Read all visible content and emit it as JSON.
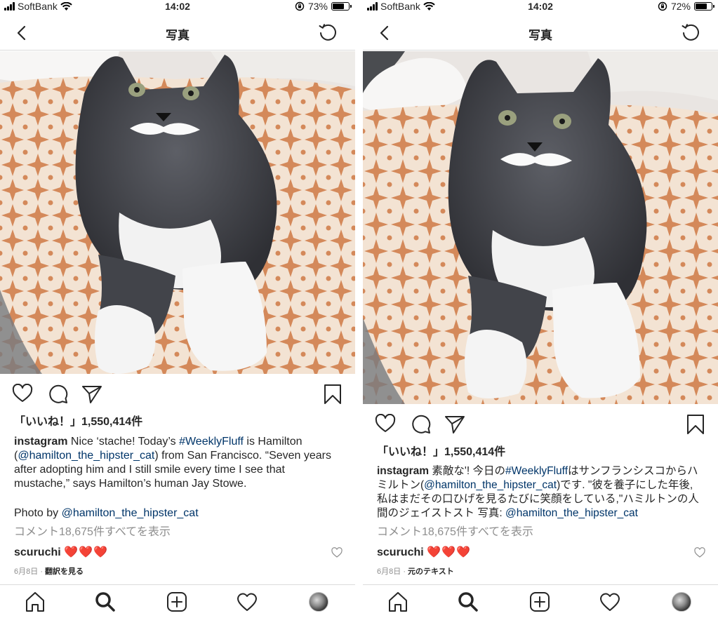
{
  "screens": [
    {
      "status": {
        "carrier": "SoftBank",
        "time": "14:02",
        "battery": "73%",
        "battery_level": 0.73
      },
      "nav": {
        "title": "写真"
      },
      "likes": "「いいね！」1,550,414件",
      "caption": {
        "username": "instagram",
        "segments": [
          {
            "t": " Nice ‘stache! Today’s ",
            "k": "text"
          },
          {
            "t": "#WeeklyFluff",
            "k": "hashtag"
          },
          {
            "t": " is Hamilton (",
            "k": "text"
          },
          {
            "t": "@hamilton_the_hipster_cat",
            "k": "mention"
          },
          {
            "t": ") from San Francisco. “Seven years after adopting him and I still smile every time I see that mustache,” says Hamilton’s human Jay Stowe.",
            "k": "text"
          }
        ],
        "credit_prefix": "Photo by ",
        "credit_mention": "@hamilton_the_hipster_cat"
      },
      "view_comments": "コメント18,675件すべてを表示",
      "comment": {
        "username": "scuruchi",
        "hearts": "❤️❤️❤️",
        "date": "6月8日",
        "action": "翻訳を見る"
      }
    },
    {
      "status": {
        "carrier": "SoftBank",
        "time": "14:02",
        "battery": "72%",
        "battery_level": 0.72
      },
      "nav": {
        "title": "写真"
      },
      "likes": "「いいね！」1,550,414件",
      "caption": {
        "username": "instagram",
        "segments": [
          {
            "t": " 素敵な'! 今日の",
            "k": "text"
          },
          {
            "t": "#WeeklyFluff",
            "k": "hashtag"
          },
          {
            "t": "はサンフランシスコからハミルトン(",
            "k": "text"
          },
          {
            "t": "@hamilton_the_hipster_cat",
            "k": "mention"
          },
          {
            "t": ")です. \"彼を養子にした年後, 私はまだその口ひげを見るたびに笑顔をしている,\"ハミルトンの人間のジェイストスト 写真: ",
            "k": "text"
          },
          {
            "t": "@hamilton_the_hipster_cat",
            "k": "mention"
          }
        ],
        "credit_prefix": "",
        "credit_mention": ""
      },
      "view_comments": "コメント18,675件すべてを表示",
      "comment": {
        "username": "scuruchi",
        "hearts": "❤️❤️❤️",
        "date": "6月8日",
        "action": "元のテキスト"
      }
    }
  ],
  "icons": {
    "back": "chevron-left-icon",
    "refresh": "refresh-icon",
    "like": "heart-outline-icon",
    "comment": "comment-bubble-icon",
    "share": "paper-plane-icon",
    "save": "bookmark-icon",
    "home": "home-icon",
    "search": "search-icon",
    "new_post": "plus-square-icon",
    "activity": "heart-outline-icon",
    "profile": "avatar"
  },
  "colors": {
    "text": "#262626",
    "link": "#003569",
    "muted": "#8e8e8e",
    "heart": "#ed4956",
    "border": "#dbdbdb"
  }
}
